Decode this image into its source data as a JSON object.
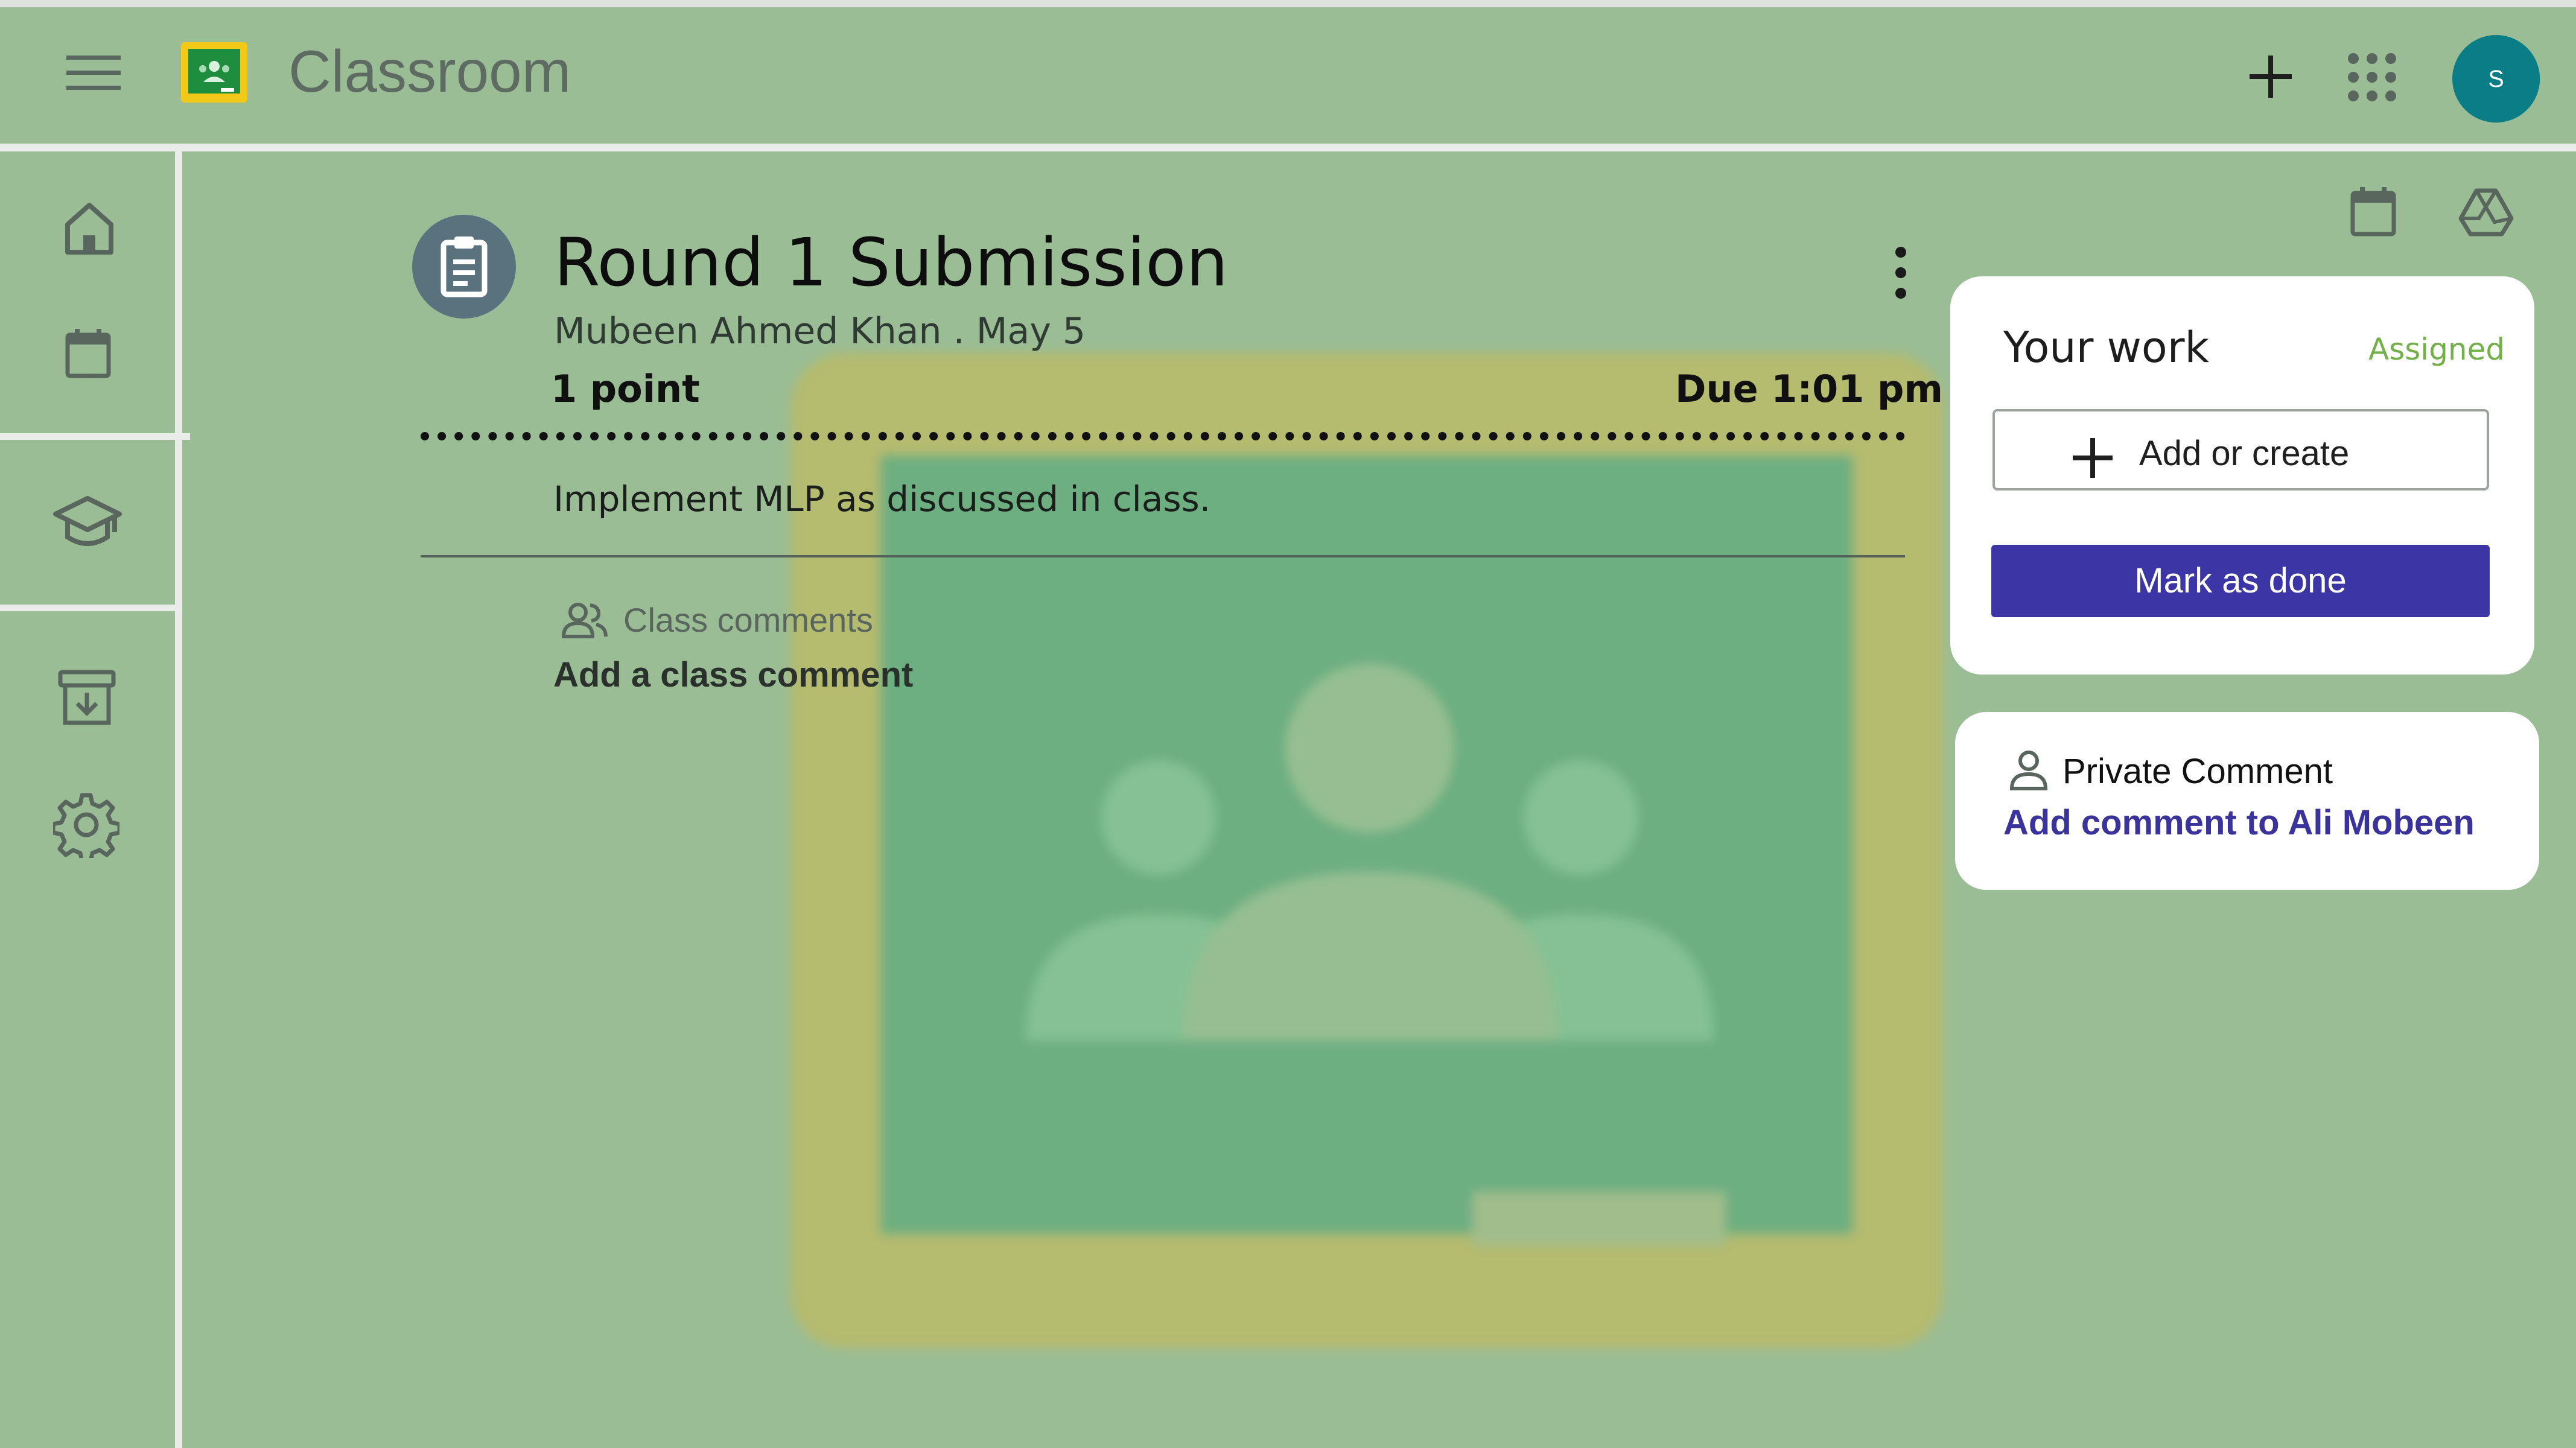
{
  "app": {
    "title": "Classroom",
    "avatar_letter": "S"
  },
  "header": {
    "menu_icon": "hamburger-menu-icon",
    "logo_icon": "classroom-logo-icon",
    "create_icon": "plus-icon",
    "apps_icon": "apps-grid-icon"
  },
  "sidebar": {
    "items": [
      "home-icon",
      "calendar-icon",
      "enrolled-classes-icon",
      "archive-icon",
      "settings-icon"
    ]
  },
  "toolbar": {
    "icons": [
      "calendar-icon",
      "drive-icon"
    ]
  },
  "assignment": {
    "title": "Round 1 Submission",
    "meta": "Mubeen Ahmed Khan . May 5",
    "points": "1 point",
    "due": "Due 1:01 pm",
    "instructions": "Implement MLP as discussed in class."
  },
  "class_comments": {
    "label": "Class comments",
    "add": "Add a class comment"
  },
  "your_work": {
    "title": "Your work",
    "status": "Assigned",
    "add_label": "Add or create",
    "done_label": "Mark as done"
  },
  "private_comment": {
    "title": "Private Comment",
    "add_link": "Add comment to Ali Mobeen"
  },
  "colors": {
    "background": "#9bbd95",
    "accent": "#3b35a6",
    "status_green": "#73b049",
    "avatar": "#0a7d86"
  }
}
